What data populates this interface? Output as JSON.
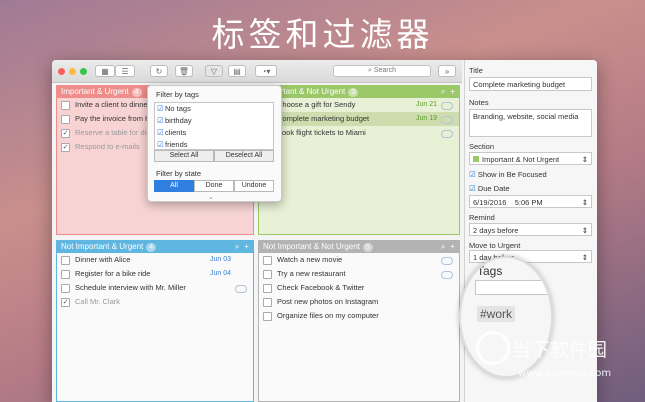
{
  "banner": {
    "title": "标签和过滤器"
  },
  "toolbar": {
    "search_placeholder": "Search"
  },
  "quadrants": {
    "iu": {
      "title": "Important & Urgent",
      "count": "4",
      "color": "#ee8d8a",
      "items": [
        {
          "text": "Invite a client to dinner",
          "checked": false,
          "date": ""
        },
        {
          "text": "Pay the invoice from H",
          "checked": false,
          "date": ""
        },
        {
          "text": "Reserve a table for din",
          "checked": true,
          "date": ""
        },
        {
          "text": "Respond to e-mails",
          "checked": true,
          "date": ""
        }
      ]
    },
    "inu": {
      "title": "Important & Not Urgent",
      "count": "3",
      "color": "#9bc869",
      "items": [
        {
          "text": "Choose a gift for Sendy",
          "date": "Jun 21"
        },
        {
          "text": "Complete marketing budget",
          "date": "Jun 19"
        },
        {
          "text": "Book flight tickets to Miami",
          "date": ""
        }
      ]
    },
    "niu": {
      "title": "Not Important & Urgent",
      "count": "4",
      "color": "#5fb6e0",
      "items": [
        {
          "text": "Dinner with Alice",
          "checked": false,
          "date": "Jun 03"
        },
        {
          "text": "Register for a bike ride",
          "checked": false,
          "date": "Jun 04"
        },
        {
          "text": "Schedule interview with Mr. Miller",
          "checked": false,
          "date": ""
        },
        {
          "text": "Call Mr. Clark",
          "checked": true,
          "date": ""
        }
      ]
    },
    "ninu": {
      "title": "Not Important & Not Urgent",
      "count": "5",
      "color": "#b3b3b3",
      "items": [
        {
          "text": "Watch a new movie",
          "checked": false
        },
        {
          "text": "Try a new restaurant",
          "checked": false
        },
        {
          "text": "Check Facebook & Twitter",
          "checked": false
        },
        {
          "text": "Post new photos on Instagram",
          "checked": false
        },
        {
          "text": "Organize files on my computer",
          "checked": false
        }
      ]
    }
  },
  "filter_popup": {
    "tags_title": "Filter by tags",
    "tags": [
      {
        "label": "No tags",
        "checked": true
      },
      {
        "label": "birthday",
        "checked": true
      },
      {
        "label": "clients",
        "checked": true
      },
      {
        "label": "friends",
        "checked": true
      }
    ],
    "select_all": "Select All",
    "deselect_all": "Deselect All",
    "state_title": "Filter by state",
    "states": [
      "All",
      "Done",
      "Undone"
    ],
    "selected_state": "All"
  },
  "details": {
    "title_label": "Title",
    "title_value": "Complete marketing budget",
    "notes_label": "Notes",
    "notes_value": "Branding, website, social media",
    "section_label": "Section",
    "section_value": "Important & Not Urgent",
    "show_focused": "Show in Be Focused",
    "due_date_label": "Due Date",
    "due_date": "6/19/2016",
    "due_time": "5:06 PM",
    "remind_label": "Remind",
    "remind_value": "2 days before",
    "move_label": "Move to Urgent",
    "move_value": "1 day before",
    "tags_label": "Tags",
    "tag_value": "#work"
  },
  "watermark": {
    "brand": "当下软件园",
    "url": "www.downxia.com"
  }
}
